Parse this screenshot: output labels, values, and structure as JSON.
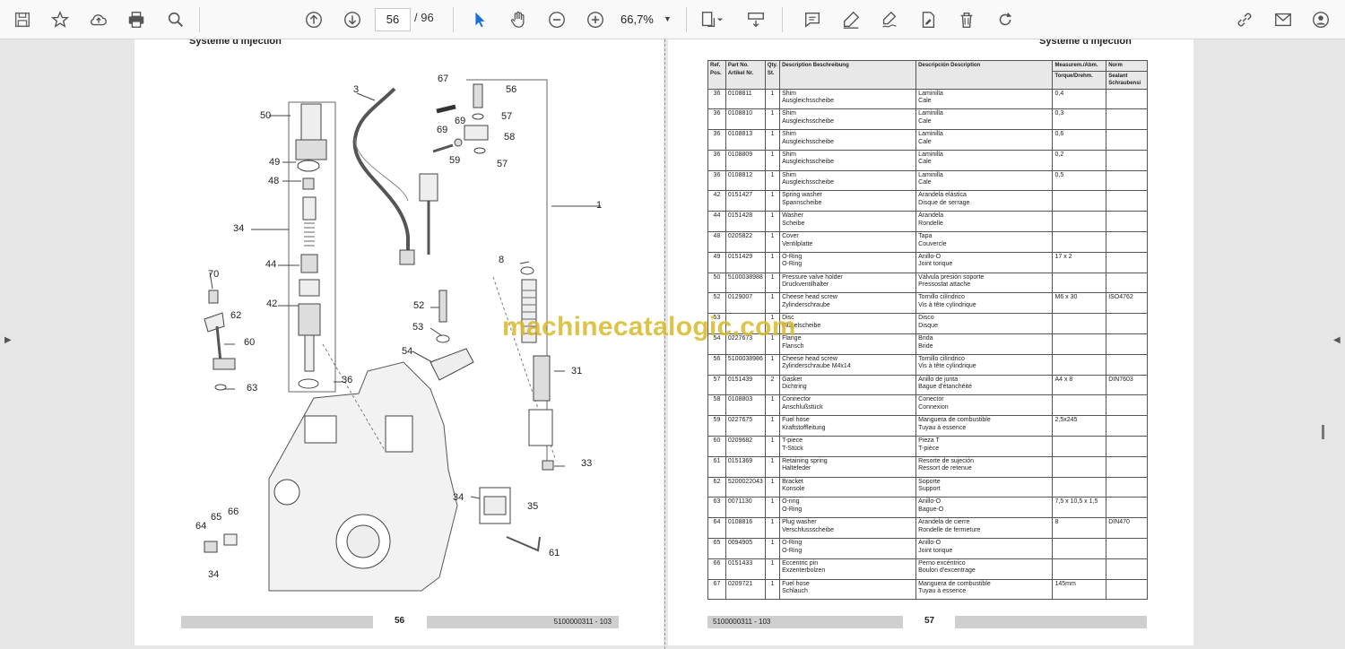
{
  "toolbar": {
    "current_page": "56",
    "total_pages": "/ 96",
    "zoom": "66,7%"
  },
  "left_page": {
    "header": "Système d'injection",
    "page_number": "56",
    "doc_code": "5100000311 - 103",
    "callouts": [
      "3",
      "67",
      "56",
      "50",
      "69",
      "69",
      "57",
      "58",
      "59",
      "57",
      "49",
      "48",
      "1",
      "34",
      "8",
      "44",
      "70",
      "62",
      "52",
      "42",
      "53",
      "60",
      "54",
      "36",
      "31",
      "63",
      "33",
      "34",
      "35",
      "64",
      "65",
      "66",
      "34",
      "61"
    ]
  },
  "right_page": {
    "header": "Système d'injection",
    "page_number": "57",
    "doc_code": "5100000311 - 103",
    "table": {
      "headers": {
        "pos": "Ref. Pos.",
        "part": "Part No. Artikel Nr.",
        "qty": "Qty. St.",
        "desc1": "Description Beschreibung",
        "desc2": "Descripción Description",
        "measure": "Measurem./Abm.",
        "torque": "Torque/Drehm.",
        "norm": "Norm",
        "sealant": "Sealant Schraubensi"
      },
      "rows": [
        {
          "pos": "36",
          "part": "0108811",
          "qty": "1",
          "d1": "Shim",
          "d1b": "Ausgleichsscheibe",
          "d2": "Laminilla",
          "d2b": "Cale",
          "measure": "0,4",
          "norm": ""
        },
        {
          "pos": "36",
          "part": "0108810",
          "qty": "1",
          "d1": "Shim",
          "d1b": "Ausgleichsscheibe",
          "d2": "Laminilla",
          "d2b": "Cale",
          "measure": "0,3",
          "norm": ""
        },
        {
          "pos": "36",
          "part": "0108813",
          "qty": "1",
          "d1": "Shim",
          "d1b": "Ausgleichsscheibe",
          "d2": "Laminilla",
          "d2b": "Cale",
          "measure": "0,6",
          "norm": ""
        },
        {
          "pos": "36",
          "part": "0108809",
          "qty": "1",
          "d1": "Shim",
          "d1b": "Ausgleichsscheibe",
          "d2": "Laminilla",
          "d2b": "Cale",
          "measure": "0,2",
          "norm": ""
        },
        {
          "pos": "36",
          "part": "0108812",
          "qty": "1",
          "d1": "Shim",
          "d1b": "Ausgleichsscheibe",
          "d2": "Laminilla",
          "d2b": "Cale",
          "measure": "0,5",
          "norm": ""
        },
        {
          "pos": "42",
          "part": "0151427",
          "qty": "1",
          "d1": "Spring washer",
          "d1b": "Spannscheibe",
          "d2": "Arandela elástica",
          "d2b": "Disque de serrage",
          "measure": "",
          "norm": ""
        },
        {
          "pos": "44",
          "part": "0151428",
          "qty": "1",
          "d1": "Washer",
          "d1b": "Scheibe",
          "d2": "Arandela",
          "d2b": "Rondelle",
          "measure": "",
          "norm": ""
        },
        {
          "pos": "48",
          "part": "0205822",
          "qty": "1",
          "d1": "Cover",
          "d1b": "Ventilplatte",
          "d2": "Tapa",
          "d2b": "Couvercle",
          "measure": "",
          "norm": ""
        },
        {
          "pos": "49",
          "part": "0151429",
          "qty": "1",
          "d1": "O-Ring",
          "d1b": "O-Ring",
          "d2": "Anillo-O",
          "d2b": "Joint torique",
          "measure": "17 x 2",
          "norm": ""
        },
        {
          "pos": "50",
          "part": "5100038988",
          "qty": "1",
          "d1": "Pressure valve holder",
          "d1b": "Druckventilhalter",
          "d2": "Válvula presión soporte",
          "d2b": "Pressostat attache",
          "measure": "",
          "norm": ""
        },
        {
          "pos": "52",
          "part": "0129007",
          "qty": "1",
          "d1": "Cheese head screw",
          "d1b": "Zylinderschraube",
          "d2": "Tornillo cilíndrico",
          "d2b": "Vis à tête cylindrique",
          "measure": "M6 x 30",
          "norm": "ISO4762"
        },
        {
          "pos": "53",
          "part": "",
          "qty": "1",
          "d1": "Disc",
          "d1b": "Flügelscheibe",
          "d2": "Disco",
          "d2b": "Disque",
          "measure": "",
          "norm": ""
        },
        {
          "pos": "54",
          "part": "0227673",
          "qty": "1",
          "d1": "Flange",
          "d1b": "Flansch",
          "d2": "Brida",
          "d2b": "Bride",
          "measure": "",
          "norm": ""
        },
        {
          "pos": "56",
          "part": "5100038986",
          "qty": "1",
          "d1": "Cheese head screw",
          "d1b": "Zylinderschraube M4x14",
          "d2": "Tornillo cilíndrico",
          "d2b": "Vis à tête cylindrique",
          "measure": "",
          "norm": ""
        },
        {
          "pos": "57",
          "part": "0151439",
          "qty": "2",
          "d1": "Gasket",
          "d1b": "Dichtring",
          "d2": "Anillo de junta",
          "d2b": "Bague d'étanchéité",
          "measure": "A4 x 8",
          "norm": "DIN7603"
        },
        {
          "pos": "58",
          "part": "0108803",
          "qty": "1",
          "d1": "Connector",
          "d1b": "Anschlußstück",
          "d2": "Conector",
          "d2b": "Connexion",
          "measure": "",
          "norm": ""
        },
        {
          "pos": "59",
          "part": "0227675",
          "qty": "1",
          "d1": "Fuel hose",
          "d1b": "Kraftstoffleitung",
          "d2": "Manguera de combustible",
          "d2b": "Tuyau à essence",
          "measure": "2,5x245",
          "norm": ""
        },
        {
          "pos": "60",
          "part": "0209682",
          "qty": "1",
          "d1": "T-piece",
          "d1b": "T-Stück",
          "d2": "Pieza T",
          "d2b": "T-pièce",
          "measure": "",
          "norm": ""
        },
        {
          "pos": "61",
          "part": "0151369",
          "qty": "1",
          "d1": "Retaining spring",
          "d1b": "Haltefeder",
          "d2": "Resorte de sujeción",
          "d2b": "Ressort de retenue",
          "measure": "",
          "norm": ""
        },
        {
          "pos": "62",
          "part": "5200022043",
          "qty": "1",
          "d1": "Bracket",
          "d1b": "Konsole",
          "d2": "Soporte",
          "d2b": "Support",
          "measure": "",
          "norm": ""
        },
        {
          "pos": "63",
          "part": "0071130",
          "qty": "1",
          "d1": "O-ring",
          "d1b": "O-Ring",
          "d2": "Anillo-O",
          "d2b": "Bague-O",
          "measure": "7,5 x 10,5 x 1,5",
          "norm": ""
        },
        {
          "pos": "64",
          "part": "0108816",
          "qty": "1",
          "d1": "Plug washer",
          "d1b": "Verschlussscheibe",
          "d2": "Arandela de cierre",
          "d2b": "Rondelle de fermeture",
          "measure": "8",
          "norm": "DIN470"
        },
        {
          "pos": "65",
          "part": "0094905",
          "qty": "1",
          "d1": "O-Ring",
          "d1b": "O-Ring",
          "d2": "Anillo-O",
          "d2b": "Joint torique",
          "measure": "",
          "norm": ""
        },
        {
          "pos": "66",
          "part": "0151433",
          "qty": "1",
          "d1": "Eccentric pin",
          "d1b": "Exzenterbolzen",
          "d2": "Perno excéntrico",
          "d2b": "Boulon d'excentrage",
          "measure": "",
          "norm": ""
        },
        {
          "pos": "67",
          "part": "0209721",
          "qty": "1",
          "d1": "Fuel hose",
          "d1b": "Schlauch",
          "d2": "Manguera de combustible",
          "d2b": "Tuyau à essence",
          "measure": "145mm",
          "norm": ""
        }
      ]
    }
  },
  "watermark": "machinecatalogic.com"
}
